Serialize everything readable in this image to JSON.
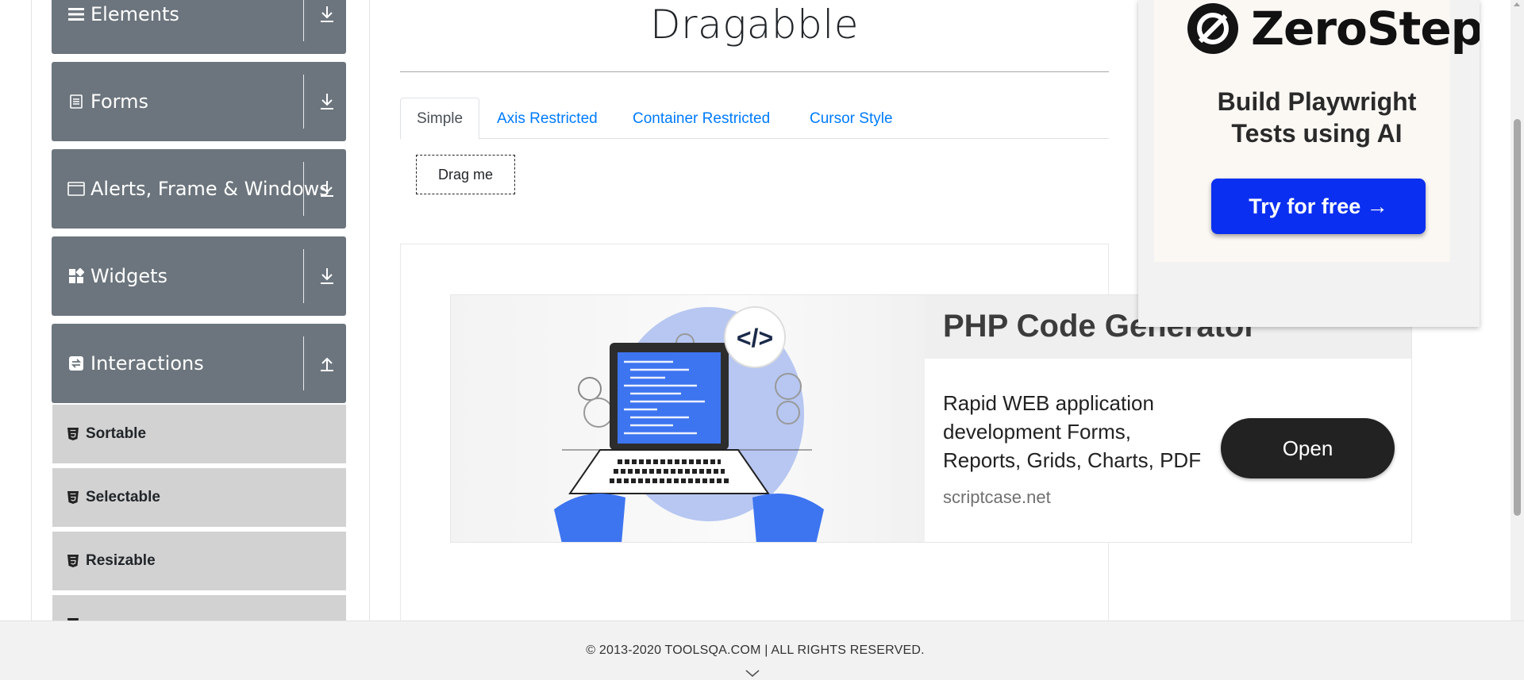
{
  "sidebar": {
    "groups": [
      {
        "label": "Elements",
        "icon": "hamburger-icon",
        "arrow": "download-arrow-icon"
      },
      {
        "label": "Forms",
        "icon": "document-icon",
        "arrow": "download-arrow-icon"
      },
      {
        "label": "Alerts, Frame & Windows",
        "icon": "window-icon",
        "arrow": "download-arrow-icon"
      },
      {
        "label": "Widgets",
        "icon": "widgets-icon",
        "arrow": "download-arrow-icon"
      },
      {
        "label": "Interactions",
        "icon": "interactions-icon",
        "arrow": "upload-arrow-icon"
      }
    ],
    "items": [
      {
        "label": "Sortable",
        "icon": "html5-icon"
      },
      {
        "label": "Selectable",
        "icon": "html5-icon"
      },
      {
        "label": "Resizable",
        "icon": "html5-icon"
      }
    ]
  },
  "main": {
    "title": "Dragabble",
    "tabs": [
      {
        "label": "Simple",
        "active": true
      },
      {
        "label": "Axis Restricted",
        "active": false
      },
      {
        "label": "Container Restricted",
        "active": false
      },
      {
        "label": "Cursor Style",
        "active": false
      }
    ],
    "drag_box": "Drag me"
  },
  "ad": {
    "headline": "PHP Code Generator",
    "body": "Rapid WEB application development Forms, Reports, Grids, Charts, PDF",
    "url": "scriptcase.net",
    "cta": "Open"
  },
  "zerostep": {
    "brand": "ZeroStep",
    "tagline": "Build Playwright Tests using AI",
    "cta": "Try for free →"
  },
  "footer": {
    "copyright": "© 2013-2020 TOOLSQA.COM | ALL RIGHTS RESERVED."
  },
  "colors": {
    "sidebar_group": "#6c757d",
    "sidebar_item": "#d2d2d2",
    "link": "#007bff",
    "zerostep_button": "#0b2ff0"
  }
}
